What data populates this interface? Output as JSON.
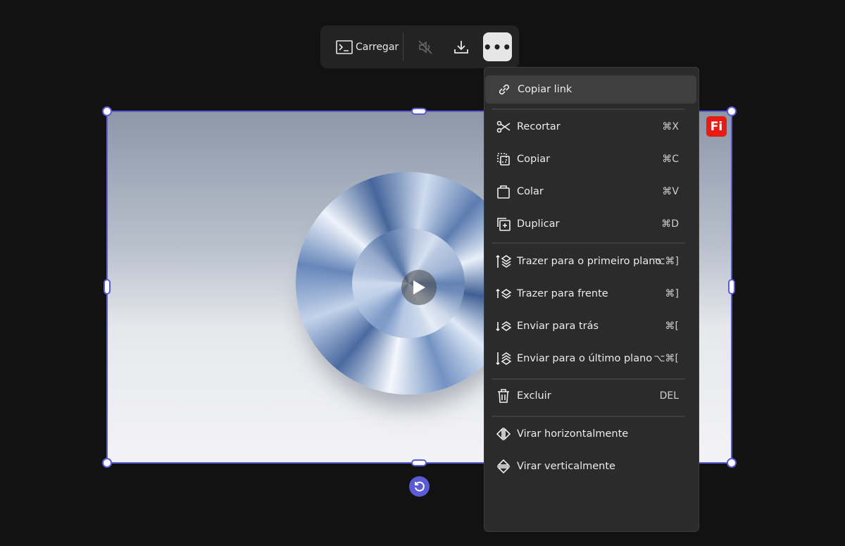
{
  "toolbar": {
    "upload_label": "Carregar",
    "icons": [
      "terminal-icon",
      "muted-speaker-icon",
      "download-icon",
      "more-icon"
    ],
    "more_label": "•••"
  },
  "canvas": {
    "badge": "Fi",
    "accent": "#5b5bd6",
    "badge_color": "#e81b14"
  },
  "menu": {
    "items": [
      {
        "label": "Copiar link",
        "shortcut": "",
        "icon": "link-icon"
      },
      {
        "label": "Recortar",
        "shortcut": "⌘X",
        "icon": "scissors-icon"
      },
      {
        "label": "Copiar",
        "shortcut": "⌘C",
        "icon": "copy-icon"
      },
      {
        "label": "Colar",
        "shortcut": "⌘V",
        "icon": "paste-icon"
      },
      {
        "label": "Duplicar",
        "shortcut": "⌘D",
        "icon": "duplicate-icon"
      },
      {
        "label": "Trazer para o primeiro plano",
        "shortcut": "⌥⌘]",
        "icon": "bring-to-front-icon"
      },
      {
        "label": "Trazer para frente",
        "shortcut": "⌘]",
        "icon": "bring-forward-icon"
      },
      {
        "label": "Enviar para trás",
        "shortcut": "⌘[",
        "icon": "send-backward-icon"
      },
      {
        "label": "Enviar para o último plano",
        "shortcut": "⌥⌘[",
        "icon": "send-to-back-icon"
      },
      {
        "label": "Excluir",
        "shortcut": "DEL",
        "icon": "trash-icon"
      },
      {
        "label": "Virar horizontalmente",
        "shortcut": "",
        "icon": "flip-horizontal-icon"
      },
      {
        "label": "Virar verticalmente",
        "shortcut": "",
        "icon": "flip-vertical-icon"
      }
    ]
  }
}
